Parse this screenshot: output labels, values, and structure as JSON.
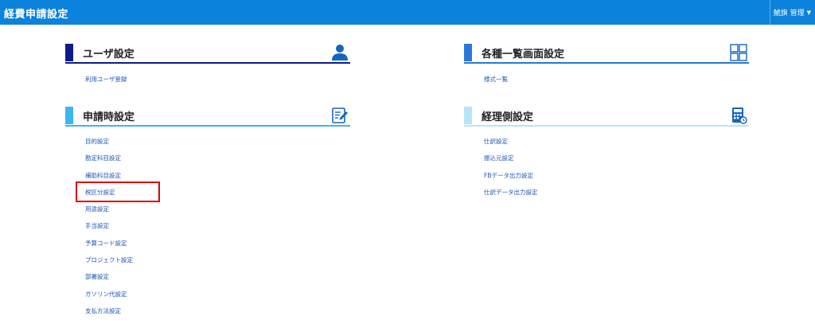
{
  "app": {
    "title": "経費申請設定"
  },
  "user_menu": {
    "label": "鯱旗 管理"
  },
  "sections": {
    "user_settings": {
      "title": "ユーザ設定",
      "icon": "user-icon",
      "accent": "#0c1d8a",
      "items": [
        "利用ユーザ登録"
      ]
    },
    "list_screen_settings": {
      "title": "各種一覧画面設定",
      "icon": "grid-icon",
      "accent": "#2a78d6",
      "items": [
        "様式一覧"
      ]
    },
    "application_settings": {
      "title": "申請時設定",
      "icon": "edit-document-icon",
      "accent": "#3fb5ee",
      "items": [
        "目的設定",
        "勘定科目設定",
        "補助科目設定",
        "税区分設定",
        "用途設定",
        "手当設定",
        "予算コード設定",
        "プロジェクト設定",
        "部署設定",
        "ガソリン代設定",
        "支払方法設定"
      ]
    },
    "accounting_settings": {
      "title": "経理側設定",
      "icon": "calculator-icon",
      "accent": "#b5e6f7",
      "items": [
        "仕訳設定",
        "振込元設定",
        "FBデータ出力設定",
        "仕訳データ出力設定"
      ]
    }
  },
  "highlighted_item": "税区分設定"
}
